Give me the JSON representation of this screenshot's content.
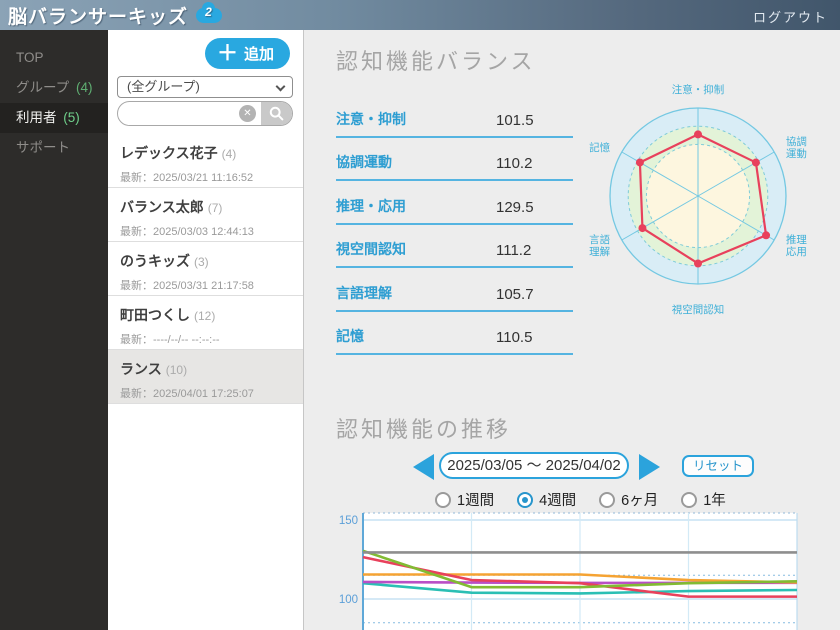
{
  "header": {
    "app_title": "脳バランサーキッズ",
    "app_badge": "2",
    "logout_label": "ログアウト"
  },
  "sidebar": {
    "items": [
      {
        "label": "TOP",
        "count": ""
      },
      {
        "label": "グループ",
        "count": "(4)"
      },
      {
        "label": "利用者",
        "count": "(5)"
      },
      {
        "label": "サポート",
        "count": ""
      }
    ]
  },
  "user_panel": {
    "add_label": "追加",
    "group_filter": "(全グループ)",
    "search_value": "",
    "users": [
      {
        "name": "レデックス花子",
        "count": "(4)",
        "latest": "最新：2025/03/21 11:16:52"
      },
      {
        "name": "バランス太郎",
        "count": "(7)",
        "latest": "最新：2025/03/03 12:44:13"
      },
      {
        "name": "のうキッズ",
        "count": "(3)",
        "latest": "最新：2025/03/31 21:17:58"
      },
      {
        "name": "町田つくし",
        "count": "(12)",
        "latest": "最新：----/--/-- --:--:--"
      },
      {
        "name": "ランス",
        "count": "(10)",
        "latest": "最新：2025/04/01 17:25:07"
      }
    ],
    "selected_user_index": 4
  },
  "balance": {
    "title": "認知機能バランス",
    "metrics": [
      {
        "label": "注意・抑制",
        "value": "101.5"
      },
      {
        "label": "協調運動",
        "value": "110.2"
      },
      {
        "label": "推理・応用",
        "value": "129.5"
      },
      {
        "label": "視空間認知",
        "value": "111.2"
      },
      {
        "label": "言語理解",
        "value": "105.7"
      },
      {
        "label": "記憶",
        "value": "110.5"
      }
    ]
  },
  "trend": {
    "title": "認知機能の推移",
    "date_range": "2025/03/05 ～ 2025/04/02",
    "reset_label": "リセット",
    "period_options": [
      {
        "label": "1週間",
        "selected": false
      },
      {
        "label": "4週間",
        "selected": true
      },
      {
        "label": "6ヶ月",
        "selected": false
      },
      {
        "label": "1年",
        "selected": false
      }
    ]
  },
  "chart_data": [
    {
      "type": "radar",
      "title": "認知機能バランス",
      "axes": [
        "注意・抑制",
        "協調運動",
        "推理・応用",
        "視空間認知",
        "言語理解",
        "記憶"
      ],
      "axis_label_lines": [
        [
          "注意・抑制"
        ],
        [
          "協調",
          "運動"
        ],
        [
          "推理",
          "応用"
        ],
        [
          "視空間認知"
        ],
        [
          "言語",
          "理解"
        ],
        [
          "記憶"
        ]
      ],
      "values": [
        101.5,
        110.2,
        129.5,
        111.2,
        105.7,
        110.5
      ],
      "scale_max": 145,
      "bands": {
        "inner_max": 85,
        "normal_max": 115
      },
      "colors": {
        "outer_fill": "#d9edf6",
        "normal_fill": "#e3f3d8",
        "inner_fill": "#fdf6df",
        "grid": "#74c8e2",
        "band_dash": "#7ecbd8",
        "series": "#e8415c",
        "label": "#3fb0d8"
      }
    },
    {
      "type": "line",
      "x_unit": "week",
      "x": [
        0,
        1,
        2,
        3,
        4
      ],
      "yticks": [
        150,
        100
      ],
      "band_lines": [
        115,
        85
      ],
      "grid": true,
      "legend": "none",
      "draw_order": [
        4,
        1,
        5,
        0,
        3,
        2
      ],
      "series": [
        {
          "name": "注意・抑制",
          "color": "#e8415c",
          "values": [
            126.5,
            112,
            110,
            101.5,
            101.5
          ]
        },
        {
          "name": "協調運動",
          "color": "#b94fc6",
          "values": [
            110.8,
            110.4,
            110.2,
            110.2,
            110.2
          ]
        },
        {
          "name": "推理・応用",
          "color": "#8e8e8e",
          "values": [
            129.5,
            129.5,
            129.5,
            129.5,
            129.5
          ]
        },
        {
          "name": "視空間認知",
          "color": "#82bb33",
          "values": [
            130.5,
            107.5,
            107.5,
            110,
            111.2
          ]
        },
        {
          "name": "言語理解",
          "color": "#2abfb4",
          "values": [
            110,
            104,
            103.5,
            105,
            105.7
          ]
        },
        {
          "name": "記憶",
          "color": "#f5a333",
          "values": [
            115.5,
            115.5,
            115.5,
            112,
            110.5
          ]
        }
      ]
    }
  ]
}
